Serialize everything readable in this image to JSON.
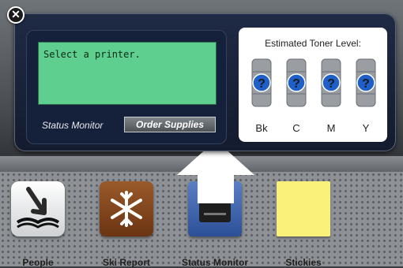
{
  "widget": {
    "close_icon": "close-icon",
    "lcd_text": "Select a printer.",
    "monitor_title": "Status Monitor",
    "order_button": "Order Supplies",
    "toner_title": "Estimated Toner Level:",
    "cartridges": [
      {
        "label": "Bk",
        "level": "unknown",
        "icon": "question-mark-icon"
      },
      {
        "label": "C",
        "level": "unknown",
        "icon": "question-mark-icon"
      },
      {
        "label": "M",
        "level": "unknown",
        "icon": "question-mark-icon"
      },
      {
        "label": "Y",
        "level": "unknown",
        "icon": "question-mark-icon"
      }
    ],
    "accent_colors": {
      "lcd": "#5fcf8f",
      "question_badge": "#1f5fc9"
    }
  },
  "dock": {
    "items": [
      {
        "label": "People",
        "icon": "people-icon"
      },
      {
        "label": "Ski Report",
        "icon": "snowflake-icon"
      },
      {
        "label": "Status Monitor",
        "icon": "printer-icon"
      },
      {
        "label": "Stickies",
        "icon": "sticky-note-icon"
      }
    ]
  },
  "hint": {
    "icon": "up-arrow-icon"
  }
}
